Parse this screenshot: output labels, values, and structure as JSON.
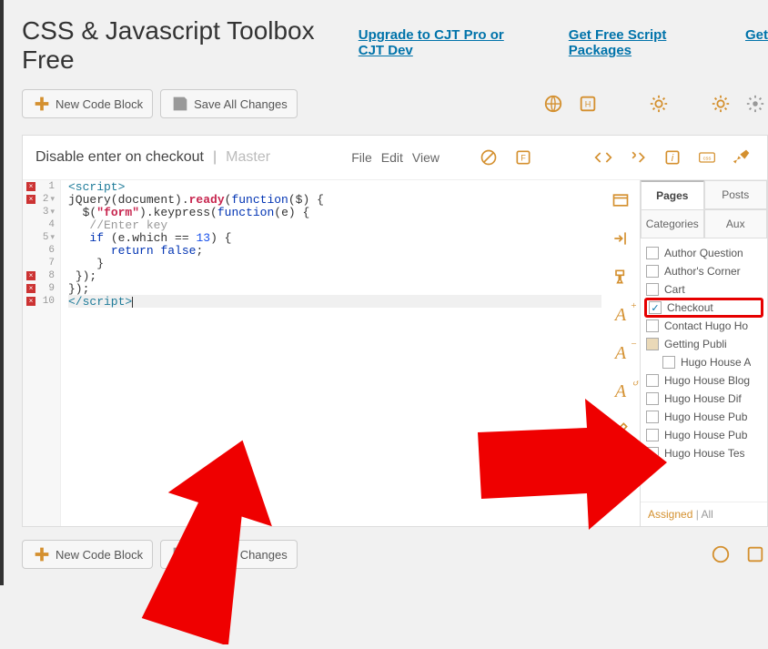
{
  "header": {
    "title": "CSS & Javascript Toolbox Free",
    "links": [
      "Upgrade to CJT Pro or CJT Dev",
      "Get Free Script Packages",
      "Get"
    ]
  },
  "toolbar": {
    "new_block": "New Code Block",
    "save_all": "Save All Changes"
  },
  "block": {
    "title": "Disable enter on checkout",
    "master": "Master",
    "menus": [
      "File",
      "Edit",
      "View"
    ]
  },
  "code": {
    "lines": [
      {
        "n": 1,
        "x": true,
        "fold": false,
        "html": "<span class='tag'>&lt;script&gt;</span>"
      },
      {
        "n": 2,
        "x": true,
        "fold": true,
        "html": "<span class='jq'>jQuery(document).</span><span class='fn'>ready</span><span class='jq'>(</span><span class='kw'>function</span><span class='jq'>($) {</span>"
      },
      {
        "n": 3,
        "x": false,
        "fold": true,
        "html": "  <span class='jq'>$(</span><span class='fn'>\"form\"</span><span class='jq'>).keypress(</span><span class='kw'>function</span><span class='jq'>(e) {</span>"
      },
      {
        "n": 4,
        "x": false,
        "fold": false,
        "html": "   <span class='cmt'>//Enter key</span>"
      },
      {
        "n": 5,
        "x": false,
        "fold": true,
        "html": "   <span class='kw'>if</span> <span class='jq'>(e.which == </span><span class='num'>13</span><span class='jq'>) {</span>"
      },
      {
        "n": 6,
        "x": false,
        "fold": false,
        "html": "      <span class='kw'>return</span> <span class='kw'>false</span><span class='jq'>;</span>"
      },
      {
        "n": 7,
        "x": false,
        "fold": false,
        "html": "    <span class='jq'>}</span>"
      },
      {
        "n": 8,
        "x": true,
        "fold": false,
        "html": " <span class='jq'>});</span>"
      },
      {
        "n": 9,
        "x": true,
        "fold": false,
        "html": "<span class='jq'>});</span>"
      },
      {
        "n": 10,
        "x": true,
        "fold": false,
        "hl": true,
        "html": "<span class='tag'>&lt;/script&gt;</span><span class='cursor-caret'></span>"
      }
    ]
  },
  "panel": {
    "tabs1": [
      "Pages",
      "Posts"
    ],
    "tabs2": [
      "Categories",
      "Aux"
    ],
    "active_tab": "Pages",
    "items": [
      {
        "label": "Author Question",
        "checked": false,
        "indent": 0
      },
      {
        "label": "Author's Corner",
        "checked": false,
        "indent": 0
      },
      {
        "label": "Cart",
        "checked": false,
        "indent": 0
      },
      {
        "label": "Checkout",
        "checked": true,
        "indent": 0,
        "highlight": true
      },
      {
        "label": "Contact Hugo Ho",
        "checked": false,
        "indent": 0
      },
      {
        "label": "Getting Publi",
        "checked": false,
        "indent": 0,
        "filled": true
      },
      {
        "label": "Hugo House A",
        "checked": false,
        "indent": 1
      },
      {
        "label": "Hugo House Blog",
        "checked": false,
        "indent": 0
      },
      {
        "label": "Hugo House Dif",
        "checked": false,
        "indent": 0
      },
      {
        "label": "Hugo House Pub",
        "checked": false,
        "indent": 0
      },
      {
        "label": "Hugo House Pub",
        "checked": false,
        "indent": 0
      },
      {
        "label": "Hugo House Tes",
        "checked": false,
        "indent": 0
      }
    ],
    "assigned": "Assigned",
    "all": "All"
  }
}
